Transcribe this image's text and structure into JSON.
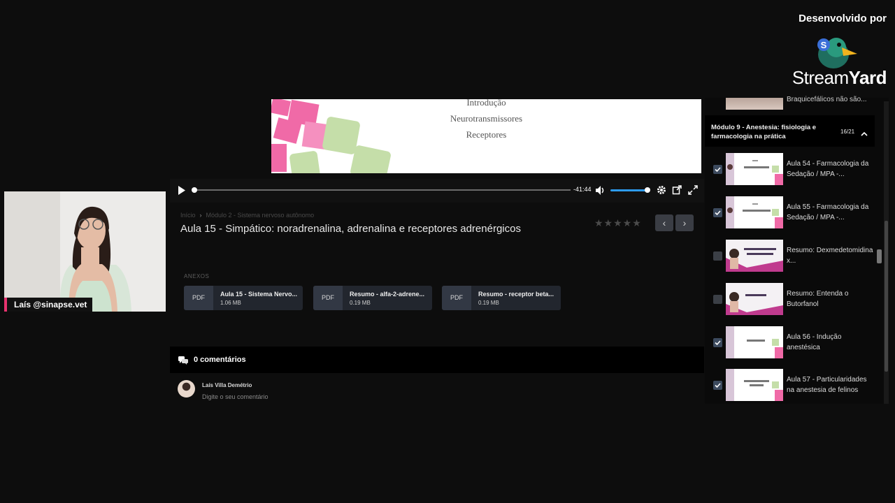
{
  "branding": {
    "caption": "Desenvolvido por",
    "name_light": "Stream",
    "name_bold": "Yard",
    "logo_icon": "duck-logo-icon"
  },
  "webcam": {
    "label": "Laís @sinapse.vet",
    "accent": "#e8336f"
  },
  "video": {
    "slide_lines": [
      "Introdução",
      "Neurotransmissores",
      "Receptores"
    ],
    "time_remaining": "-41:44",
    "progress": 0.0,
    "volume": 1.0,
    "accent": "#2d9bf0"
  },
  "lesson": {
    "breadcrumb": [
      "Início",
      "›",
      "Módulo 2 - Sistema nervoso autônomo"
    ],
    "title": "Aula 15 - Simpático: noradrenalina, adrenalina e receptores adrenérgicos",
    "rating_stars": "★★★★★",
    "prev_label": "‹",
    "next_label": "›"
  },
  "attachments": {
    "label": "ANEXOS",
    "items": [
      {
        "badge": "PDF",
        "name": "Aula 15 - Sistema Nervo...",
        "size": "1.06 MB"
      },
      {
        "badge": "PDF",
        "name": "Resumo - alfa-2-adrene...",
        "size": "0.19 MB"
      },
      {
        "badge": "PDF",
        "name": "Resumo - receptor beta...",
        "size": "0.19 MB"
      }
    ]
  },
  "comments": {
    "count_label": "0 comentários",
    "user_name": "Laís Villa Demétrio",
    "placeholder": "Digite o seu comentário"
  },
  "sidebar": {
    "previous_item": "Braquicefálicos não são...",
    "module": {
      "title": "Módulo 9 - Anestesia: fisiologia e farmacologia na prática",
      "count": "16/21"
    },
    "lessons": [
      {
        "title": "Aula 54 - Farmacologia da Sedação / MPA -...",
        "checked": true
      },
      {
        "title": "Aula 55 - Farmacologia da Sedação / MPA -...",
        "checked": true
      },
      {
        "title": "Resumo: Dexmedetomidina x...",
        "checked": false
      },
      {
        "title": "Resumo: Entenda o Butorfanol",
        "checked": false
      },
      {
        "title": "Aula 56 - Indução anestésica",
        "checked": true
      },
      {
        "title": "Aula 57 - Particularidades na anestesia de felinos",
        "checked": true
      }
    ]
  }
}
